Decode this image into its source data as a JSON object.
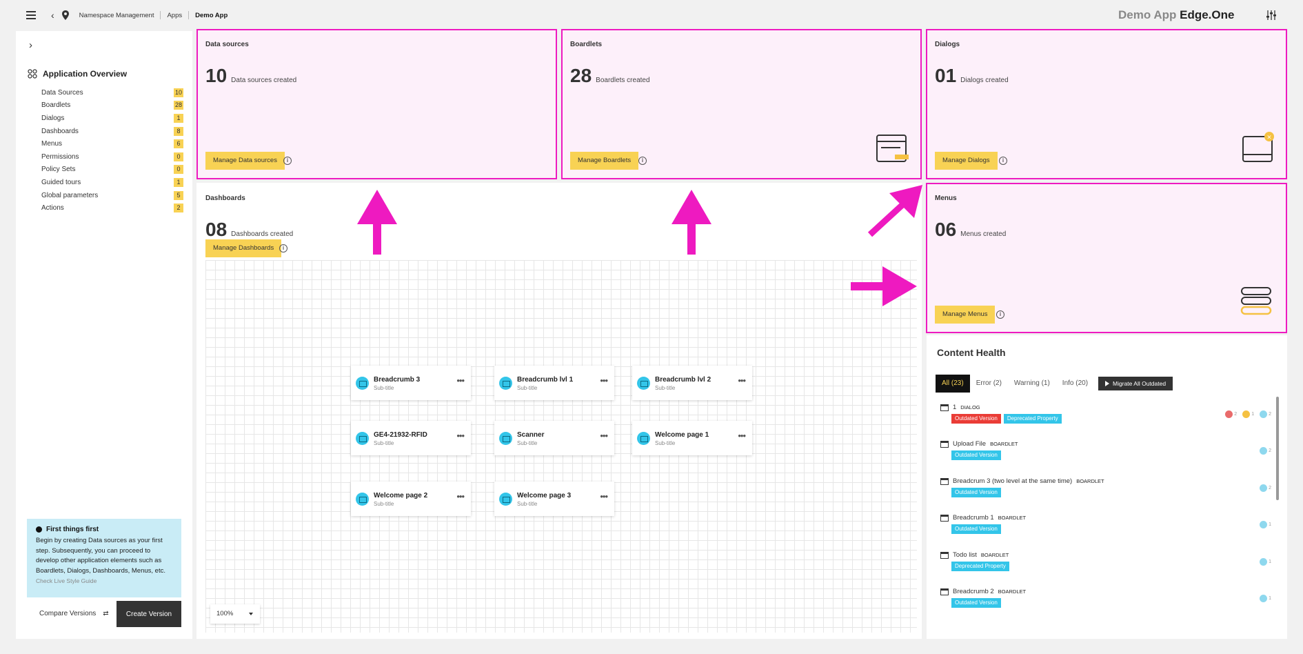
{
  "breadcrumb": [
    "Namespace Management",
    "Apps",
    "Demo App"
  ],
  "brand": {
    "app": "Demo App",
    "product": "Edge.One"
  },
  "sidebar": {
    "title": "Application Overview",
    "items": [
      {
        "label": "Data Sources",
        "count": "10"
      },
      {
        "label": "Boardlets",
        "count": "28"
      },
      {
        "label": "Dialogs",
        "count": "1"
      },
      {
        "label": "Dashboards",
        "count": "8"
      },
      {
        "label": "Menus",
        "count": "6"
      },
      {
        "label": "Permissions",
        "count": "0"
      },
      {
        "label": "Policy Sets",
        "count": "0"
      },
      {
        "label": "Guided tours",
        "count": "1"
      },
      {
        "label": "Global parameters",
        "count": "5"
      },
      {
        "label": "Actions",
        "count": "2"
      }
    ],
    "first": {
      "title": "First things first",
      "body": "Begin by creating Data sources as your first step. Subsequently, you can proceed to develop other application elements such as Boardlets, Dialogs, Dashboards, Menus, etc.",
      "link": "Check Live Style Guide"
    },
    "compare": "Compare Versions",
    "create": "Create Version"
  },
  "cards": {
    "datasources": {
      "title": "Data sources",
      "num": "10",
      "desc": "Data sources created",
      "button": "Manage Data sources"
    },
    "boardlets": {
      "title": "Boardlets",
      "num": "28",
      "desc": "Boardlets created",
      "button": "Manage Boardlets"
    },
    "dialogs": {
      "title": "Dialogs",
      "num": "01",
      "desc": "Dialogs created",
      "button": "Manage Dialogs"
    },
    "dashboards": {
      "title": "Dashboards",
      "num": "08",
      "desc": "Dashboards created",
      "button": "Manage Dashboards"
    },
    "menus": {
      "title": "Menus",
      "num": "06",
      "desc": "Menus created",
      "button": "Manage Menus"
    }
  },
  "tiles": [
    {
      "name": "Breadcrumb 3",
      "sub": "Sub-title"
    },
    {
      "name": "Breadcrumb lvl 1",
      "sub": "Sub-title"
    },
    {
      "name": "Breadcrumb lvl 2",
      "sub": "Sub-title"
    },
    {
      "name": "GE4-21932-RFID",
      "sub": "Sub-title"
    },
    {
      "name": "Scanner",
      "sub": "Sub-title"
    },
    {
      "name": "Welcome page 1",
      "sub": "Sub-title"
    },
    {
      "name": "Welcome page 2",
      "sub": "Sub-title"
    },
    {
      "name": "Welcome page 3",
      "sub": "Sub-title"
    }
  ],
  "zoom": "100%",
  "health": {
    "title": "Content Health",
    "tabs": [
      "All (23)",
      "Error (2)",
      "Warning (1)",
      "Info (20)"
    ],
    "migrate": "Migrate All Outdated",
    "items": [
      {
        "name": "1",
        "type": "DIALOG",
        "tags": [
          "Outdated Version",
          "Deprecated Property"
        ],
        "counts": [
          "2",
          "1",
          "2"
        ]
      },
      {
        "name": "Upload File",
        "type": "BOARDLET",
        "tags": [
          "Outdated Version"
        ],
        "counts": [
          "2"
        ]
      },
      {
        "name": "Breadcrum 3 (two level at the same time)",
        "type": "BOARDLET",
        "tags": [
          "Outdated Version"
        ],
        "counts": [
          "2"
        ]
      },
      {
        "name": "Breadcrumb 1",
        "type": "BOARDLET",
        "tags": [
          "Outdated Version"
        ],
        "counts": [
          "1"
        ]
      },
      {
        "name": "Todo list",
        "type": "BOARDLET",
        "tags": [
          "Deprecated Property"
        ],
        "counts": [
          "1"
        ]
      },
      {
        "name": "Breadcrumb 2",
        "type": "BOARDLET",
        "tags": [
          "Outdated Version"
        ],
        "counts": [
          "1"
        ]
      }
    ]
  },
  "colors": {
    "highlight": "#ee1ac0",
    "accent": "#f8d254",
    "info": "#33c5e9",
    "error": "#ea3c36"
  }
}
